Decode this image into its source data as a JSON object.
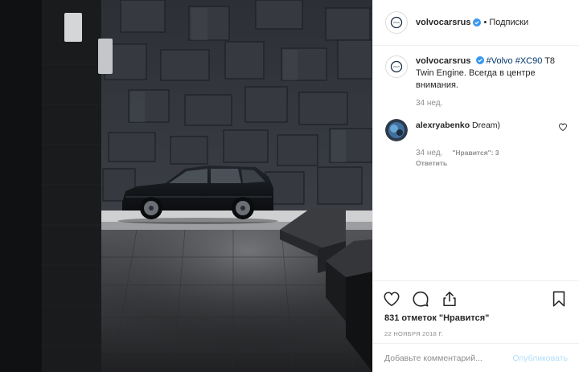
{
  "post": {
    "username": "volvocarsrus",
    "follow_dot": "•",
    "follow_label": "Подписки",
    "caption_username": "volvocarsrus",
    "caption_tag1": "#Volvo",
    "caption_tag2": "#XC90",
    "caption_text": "T8 Twin Engine. Всегда в центре внимания.",
    "caption_age": "34 нед."
  },
  "comments": [
    {
      "username": "alexryabenko",
      "text": "Dream)",
      "age": "34 нед.",
      "likes": "\"Нравится\": 3",
      "reply_label": "Ответить"
    }
  ],
  "stats": {
    "likes_text": "831 отметок \"Нравится\"",
    "date": "22 НОЯБРЯ 2018 Г."
  },
  "comment_box": {
    "placeholder": "Добавьте комментарий...",
    "publish_label": "Опубликовать"
  },
  "icons": {
    "like": "heart-icon",
    "comment": "comment-icon",
    "share": "share-icon",
    "save": "bookmark-icon",
    "verified": "verified-badge-icon",
    "brand": "volvo-logo-icon"
  },
  "colors": {
    "hashtag": "#003569",
    "verified": "#3897f0",
    "muted": "#8e8e8e",
    "publish_disabled": "#b2dffc"
  }
}
